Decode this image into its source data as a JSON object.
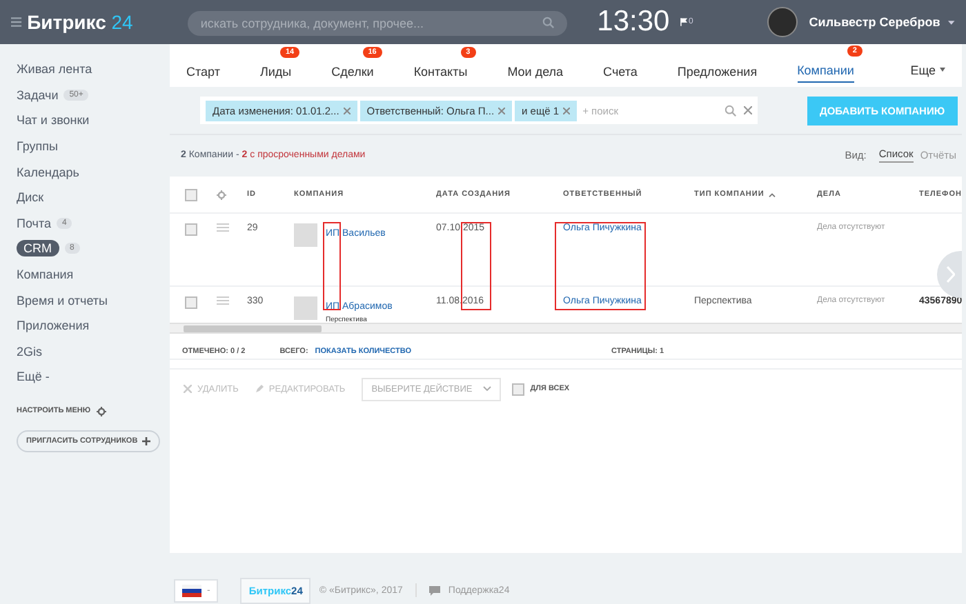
{
  "header": {
    "logo_text": "Битрикс",
    "logo_number": "24",
    "search": {
      "placeholder": "искать сотрудника, документ, прочее..."
    },
    "time": "13:30",
    "flag_count": "0",
    "user_name": "Сильвестр Серебров"
  },
  "sidebar": {
    "items": [
      {
        "label": "Живая лента",
        "selected": false
      },
      {
        "label": "Задачи",
        "counter": "50+",
        "selected": false
      },
      {
        "label": "Чат и звонки",
        "selected": false
      },
      {
        "label": "Группы",
        "selected": false
      },
      {
        "label": "Календарь",
        "selected": false
      },
      {
        "label": "Диск",
        "selected": false
      },
      {
        "label": "Почта",
        "counter": "4",
        "selected": false
      },
      {
        "label": "CRM",
        "counter": "8",
        "selected": true
      },
      {
        "label": "Компания",
        "selected": false
      },
      {
        "label": "Время и отчеты",
        "selected": false
      },
      {
        "label": "Приложения",
        "selected": false
      },
      {
        "label": "2Gis",
        "selected": false
      },
      {
        "label": "Ещё -",
        "selected": false
      }
    ],
    "configure_menu": "НАСТРОИТЬ МЕНЮ",
    "invite_button": "ПРИГЛАСИТЬ СОТРУДНИКОВ"
  },
  "tabs": [
    {
      "label": "Старт",
      "selected": false
    },
    {
      "label": "Лиды",
      "counter": "14",
      "selected": false
    },
    {
      "label": "Сделки",
      "counter": "16",
      "selected": false
    },
    {
      "label": "Контакты",
      "counter": "3",
      "selected": false
    },
    {
      "label": "Мои дела",
      "selected": false
    },
    {
      "label": "Счета",
      "selected": false
    },
    {
      "label": "Предложения",
      "selected": false
    },
    {
      "label": "Компании",
      "counter": "2",
      "selected": true
    }
  ],
  "more_tab": "Еще",
  "filter": {
    "chips": [
      {
        "label": "Дата изменения: 01.01.2..."
      },
      {
        "label": "Ответственный: Ольга П..."
      },
      {
        "label": "и ещё 1"
      }
    ],
    "placeholder": "+ поиск"
  },
  "add_button": "ДОБАВИТЬ КОМПАНИЮ",
  "summary": {
    "total": "**2** Компании - ",
    "overdue": "**2** с просроченными делами"
  },
  "view": {
    "label": "Вид:",
    "options": [
      {
        "label": "Список",
        "selected": true
      },
      {
        "label": "Отчёты",
        "selected": false
      }
    ]
  },
  "table": {
    "columns": [
      {
        "kind": "checkbox",
        "checked": false
      },
      {
        "kind": "gear"
      },
      {
        "kind": "text",
        "label": "ID"
      },
      {
        "kind": "text",
        "label": "КОМПАНИЯ",
        "framed": true
      },
      {
        "kind": "text",
        "label": "ДАТА СОЗДАНИЯ",
        "framed": true
      },
      {
        "kind": "text",
        "label": "ОТВЕТСТВЕННЫЙ",
        "framed": true
      },
      {
        "kind": "text",
        "label": "ТИП КОМПАНИИ",
        "sorted": true
      },
      {
        "kind": "text",
        "label": "ДЕЛА"
      },
      {
        "kind": "text",
        "label": "ТЕЛЕФОН"
      }
    ],
    "rows": [
      {
        "checked": false,
        "id": "29",
        "company": "ИП Васильев",
        "date": "07.10.2015",
        "responsible": "Ольга Пичужкина",
        "tasks": "Дела отсутствуют"
      },
      {
        "checked": false,
        "id": "330",
        "company": "ИП Абрасимов",
        "company_type": "Перспектива",
        "date": "11.08.2016",
        "responsible": "Ольга Пичужкина",
        "type": "Перспектива",
        "tasks": "Дела отсутствуют",
        "phone": "43567890"
      }
    ]
  },
  "grid_footer": {
    "marked_label": "ОТМЕЧЕНО:",
    "marked_value": "0 / 2",
    "total_label": "ВСЕГО:",
    "total_link": "ПОКАЗАТЬ КОЛИЧЕСТВО",
    "pages_label": "СТРАНИЦЫ:",
    "pages_value": "1"
  },
  "actions": {
    "delete": "УДАЛИТЬ",
    "edit": "РЕДАКТИРОВАТЬ",
    "select_placeholder": "ВЫБЕРИТЕ ДЕЙСТВИЕ",
    "for_all": {
      "label": "ДЛЯ ВСЕХ",
      "checked": false
    }
  },
  "page_footer": {
    "language_caret": "-",
    "logo_text": "Битрикс",
    "logo_number": "24",
    "copyright": "© «Битрикс», 2017",
    "support": "Поддержка24"
  }
}
